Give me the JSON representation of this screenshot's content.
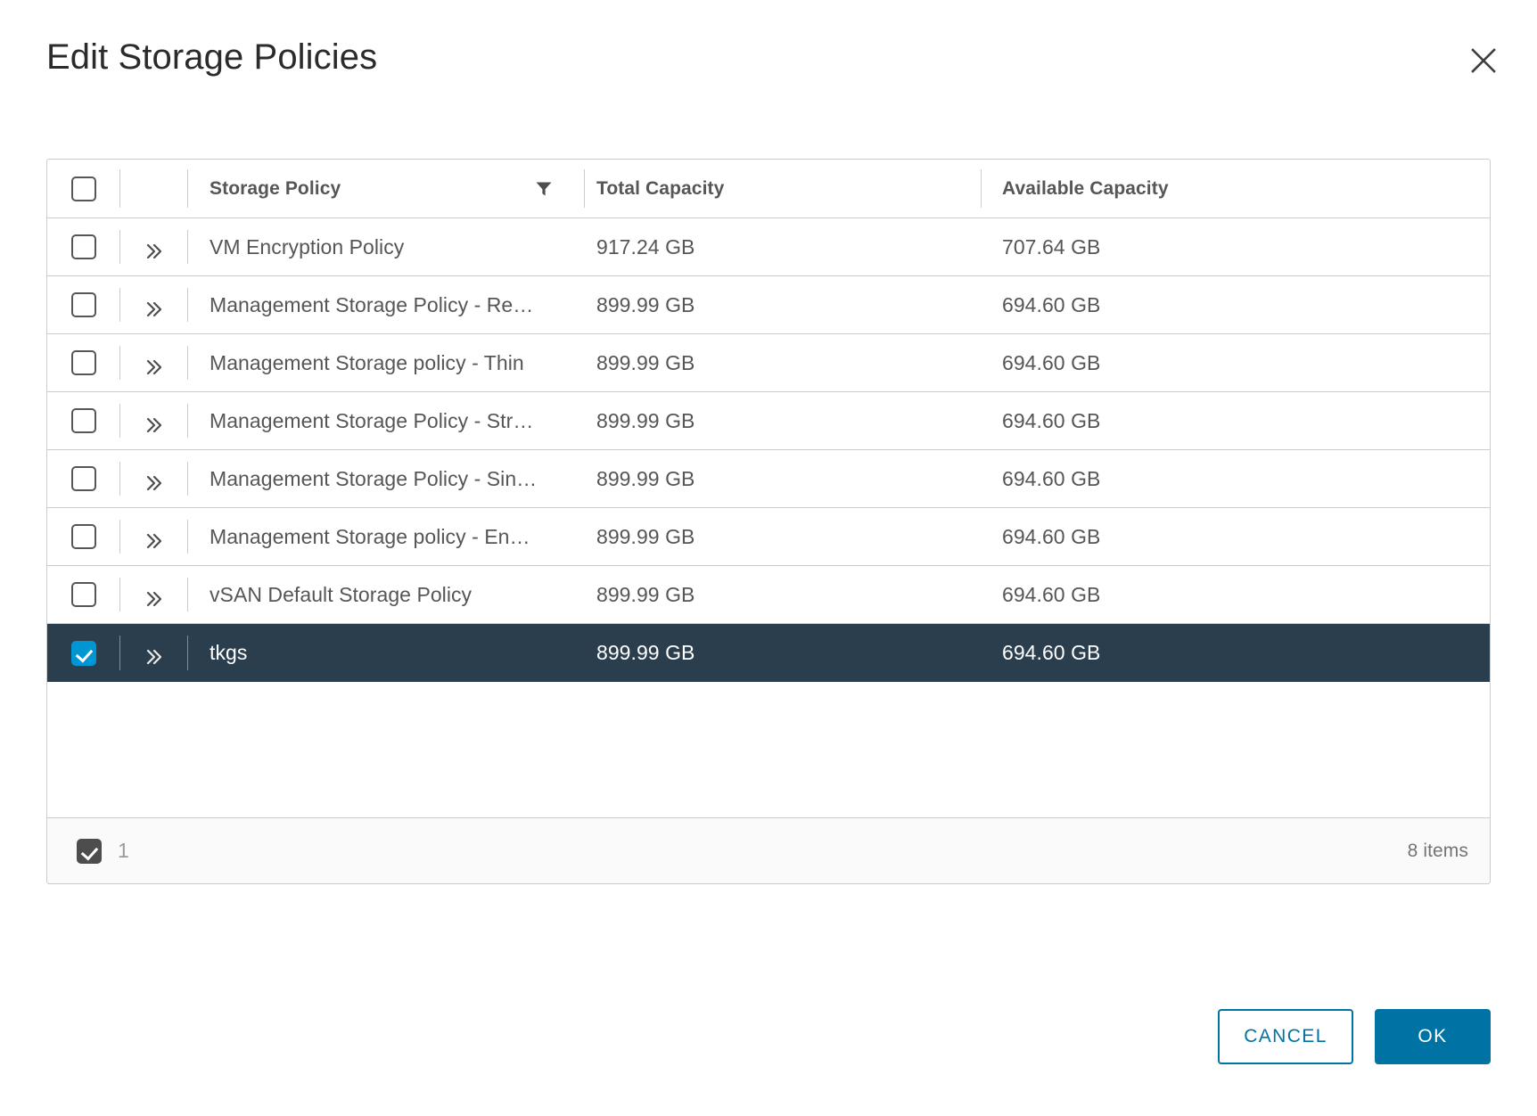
{
  "dialog": {
    "title": "Edit Storage Policies",
    "close_icon": "close-icon"
  },
  "table": {
    "columns": [
      {
        "key": "name",
        "label": "Storage Policy",
        "has_filter": true
      },
      {
        "key": "total",
        "label": "Total Capacity",
        "has_filter": false
      },
      {
        "key": "avail",
        "label": "Available Capacity",
        "has_filter": false
      }
    ],
    "rows": [
      {
        "name": "VM Encryption Policy",
        "total": "917.24 GB",
        "avail": "707.64 GB",
        "selected": false
      },
      {
        "name": "Management Storage Policy - Re…",
        "total": "899.99 GB",
        "avail": "694.60 GB",
        "selected": false
      },
      {
        "name": "Management Storage policy - Thin",
        "total": "899.99 GB",
        "avail": "694.60 GB",
        "selected": false
      },
      {
        "name": "Management Storage Policy - Str…",
        "total": "899.99 GB",
        "avail": "694.60 GB",
        "selected": false
      },
      {
        "name": "Management Storage Policy - Sin…",
        "total": "899.99 GB",
        "avail": "694.60 GB",
        "selected": false
      },
      {
        "name": "Management Storage policy - En…",
        "total": "899.99 GB",
        "avail": "694.60 GB",
        "selected": false
      },
      {
        "name": "vSAN Default Storage Policy",
        "total": "899.99 GB",
        "avail": "694.60 GB",
        "selected": false
      },
      {
        "name": "tkgs",
        "total": "899.99 GB",
        "avail": "694.60 GB",
        "selected": true
      }
    ],
    "footer": {
      "selected_count": "1",
      "items_label": "8 items"
    }
  },
  "actions": {
    "cancel_label": "CANCEL",
    "ok_label": "OK"
  },
  "colors": {
    "accent": "#0072a3",
    "checkbox_checked": "#0095d3",
    "selected_row_bg": "#2b3e4e",
    "border": "#cccccc",
    "text": "#565656"
  }
}
